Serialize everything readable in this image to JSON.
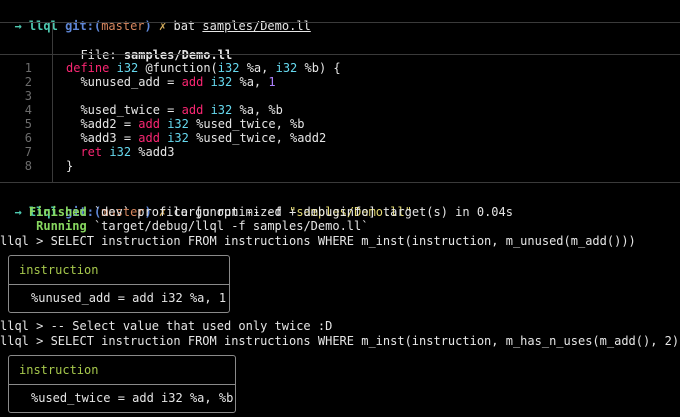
{
  "colors": {
    "background": "#000000",
    "text": "#e6e6e6",
    "prompt_arrow": "#4ec9b0",
    "dir": "#4ec9b0",
    "git_label": "#5f87d7",
    "branch": "#d7875f",
    "dirty": "#d7af5f",
    "keyword": "#f92672",
    "type": "#66d9ef",
    "string": "#e6db74",
    "number": "#ae81ff",
    "finished": "#87d75f",
    "table_header": "#a6c84c",
    "gutter": "#6c6c6c"
  },
  "prompt1": {
    "arrow": "→",
    "dir": "llql",
    "git": "git:(",
    "branch": "master",
    "git_close": ")",
    "dirty": "✗",
    "command": "bat",
    "argument": "samples/Demo.ll"
  },
  "bat": {
    "file_label": "File:",
    "file_name": "samples/Demo.ll",
    "line_numbers": [
      "1",
      "2",
      "3",
      "4",
      "5",
      "6",
      "7",
      "8"
    ],
    "code": {
      "l1": {
        "kw": "define",
        "type": "i32",
        "rest1": "@function(",
        "type2": "i32",
        "rest2": "%a,",
        "type3": "i32",
        "rest3": "%b) {"
      },
      "l2": {
        "var": "%unused_add",
        "eq": "=",
        "kw": "add",
        "type": "i32",
        "rest": "%a,",
        "num": "1"
      },
      "l4": {
        "var": "%used_twice",
        "eq": "=",
        "kw": "add",
        "type": "i32",
        "rest": "%a, %b"
      },
      "l5": {
        "var": "%add2",
        "eq": "=",
        "kw": "add",
        "type": "i32",
        "rest": "%used_twice, %b"
      },
      "l6": {
        "var": "%add3",
        "eq": "=",
        "kw": "add",
        "type": "i32",
        "rest": "%used_twice, %add2"
      },
      "l7": {
        "kw": "ret",
        "type": "i32",
        "rest": "%add3"
      },
      "l8": {
        "rest": "}"
      }
    }
  },
  "prompt2": {
    "arrow": "→",
    "dir": "llql",
    "git": "git:(",
    "branch": "master",
    "git_close": ")",
    "dirty": "✗",
    "command": "cargo run -- -f",
    "argument": "\"samples/Demo.ll\""
  },
  "cargo": {
    "finished_label": "Finished",
    "finished_text": "`dev` profile [unoptimized + debuginfo] target(s) in 0.04s",
    "running_label": "Running",
    "running_text": "`target/debug/llql -f samples/Demo.ll`"
  },
  "queries": {
    "q1": "llql > SELECT instruction FROM instructions WHERE m_inst(instruction, m_unused(m_add()))",
    "comment": "llql > -- Select value that used only twice :D",
    "q2": "llql > SELECT instruction FROM instructions WHERE m_inst(instruction, m_has_n_uses(m_add(), 2))"
  },
  "result1": {
    "header": "instruction",
    "value": "%unused_add = add i32 %a, 1"
  },
  "result2": {
    "header": "instruction",
    "value": "%used_twice = add i32 %a, %b"
  }
}
